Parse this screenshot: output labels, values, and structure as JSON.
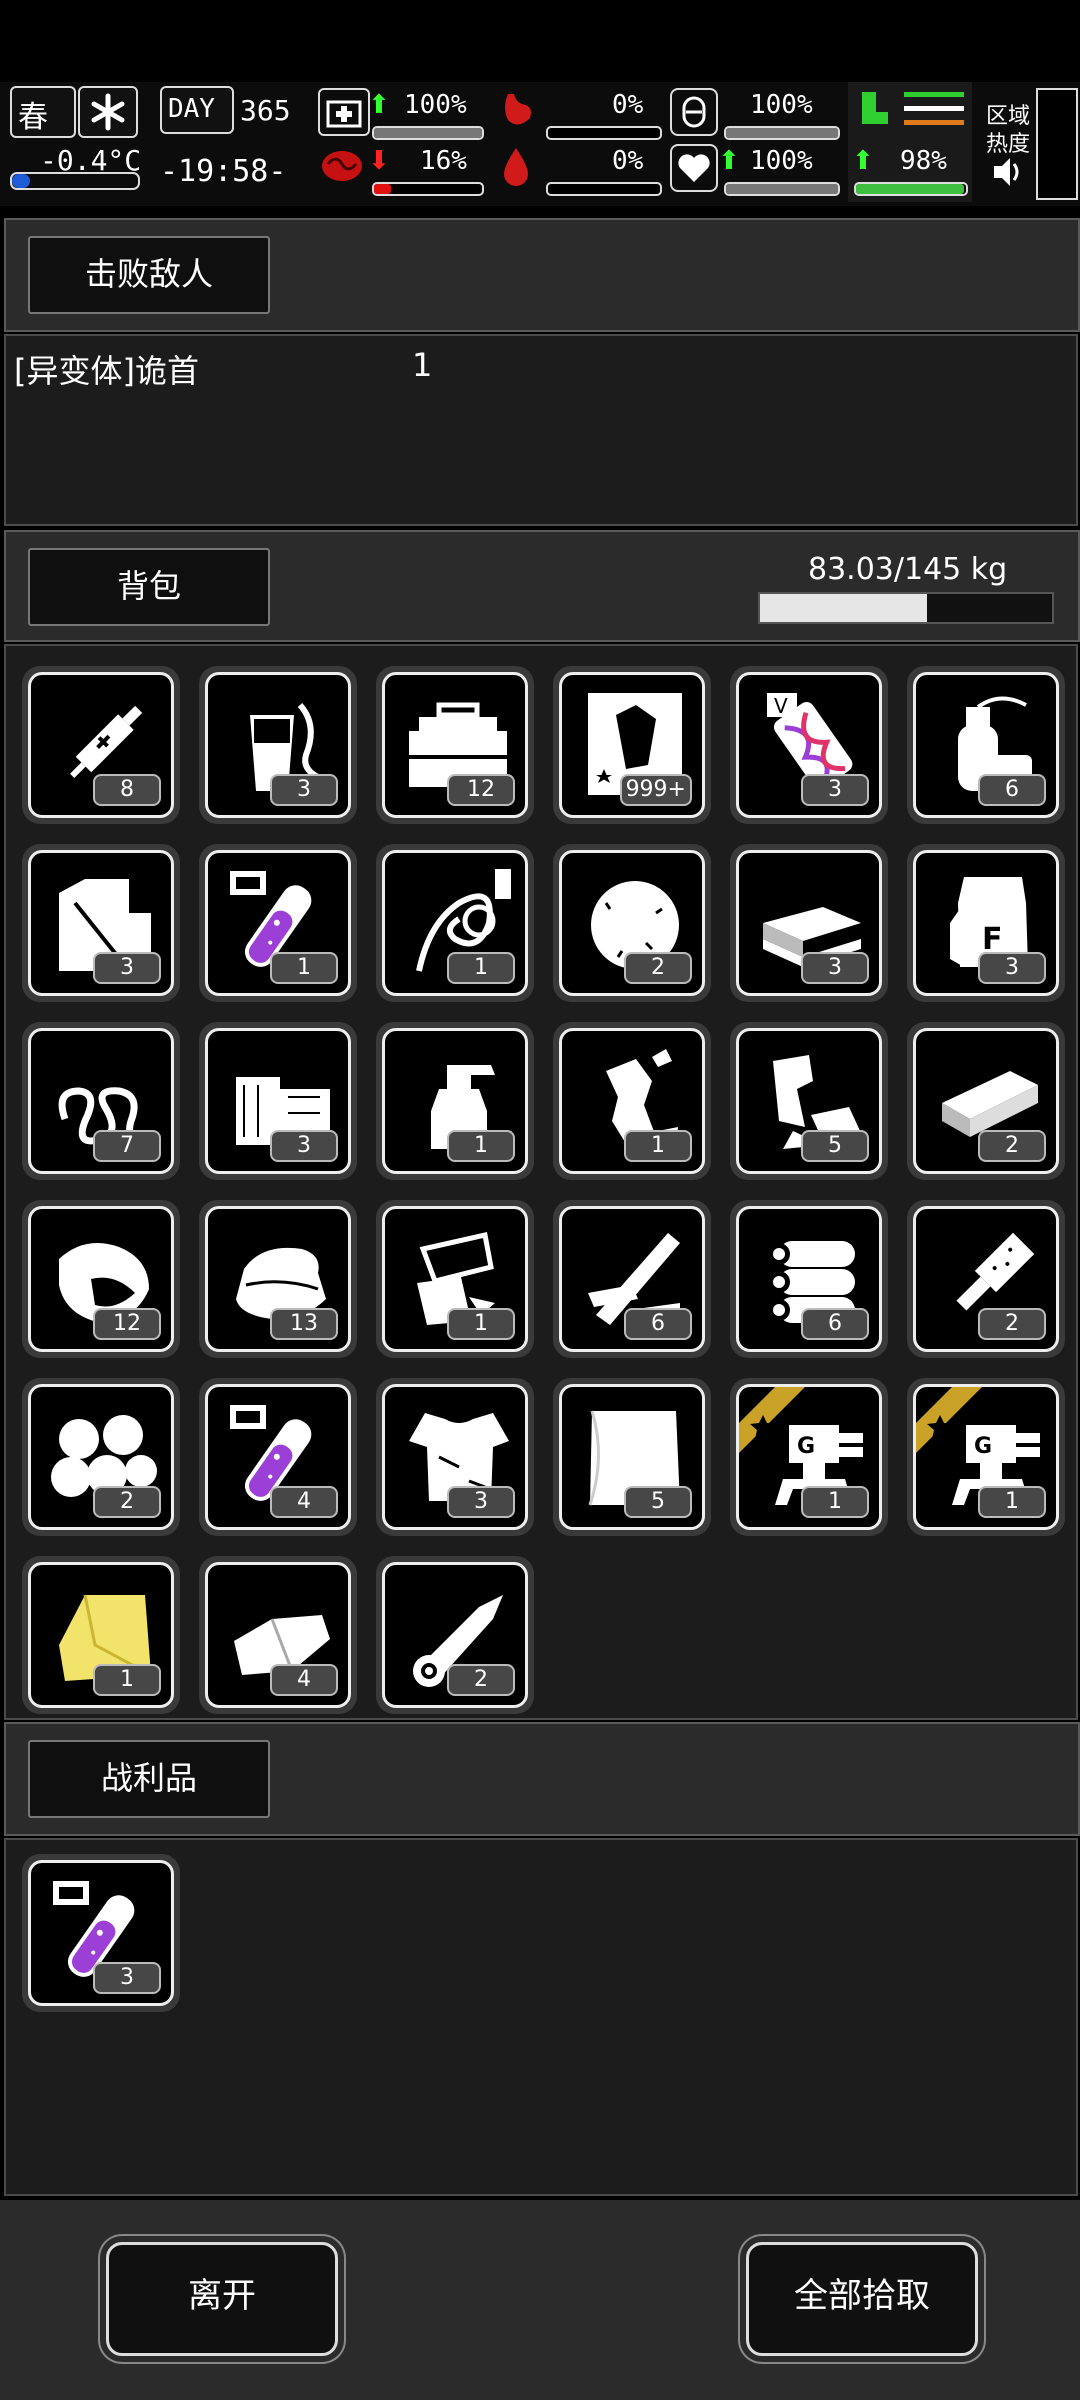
{
  "hud": {
    "season": "春",
    "temperature": "-0.4°C",
    "day_label": "DAY",
    "day_number": "365",
    "clock": "-19:58-",
    "health_pct": "100%",
    "hunger_pct": "0%",
    "armor_pct": "100%",
    "infection_pct": "16%",
    "bleed_pct": "0%",
    "heart_pct": "100%",
    "stamina_pct": "98%",
    "zone_heat_label_1": "区域",
    "zone_heat_label_2": "热度"
  },
  "sections": {
    "defeated_tab": "击败敌人",
    "backpack_tab": "背包",
    "loot_tab": "战利品"
  },
  "defeated": {
    "enemy_name": "[异变体]诡首",
    "enemy_count": "1"
  },
  "backpack": {
    "weight": "83.03/145 kg",
    "weight_fraction": 0.5726,
    "items": [
      {
        "icon": "syringe-icon",
        "count": "8"
      },
      {
        "icon": "drink-cup-icon",
        "count": "3"
      },
      {
        "icon": "toolbox-icon",
        "count": "12"
      },
      {
        "icon": "mutant-hand-card-icon",
        "count": "999+"
      },
      {
        "icon": "dna-vial-icon",
        "count": "3"
      },
      {
        "icon": "gas-canister-icon",
        "count": "6"
      },
      {
        "icon": "fuel-jerrycan-icon",
        "count": "3"
      },
      {
        "icon": "purple-test-tube-icon",
        "count": "1"
      },
      {
        "icon": "cable-icon",
        "count": "1"
      },
      {
        "icon": "cotton-icon",
        "count": "2"
      },
      {
        "icon": "stacked-planks-icon",
        "count": "3"
      },
      {
        "icon": "flour-sack-icon",
        "count": "3"
      },
      {
        "icon": "spring-icon",
        "count": "7"
      },
      {
        "icon": "wood-blocks-icon",
        "count": "3"
      },
      {
        "icon": "spray-bottle-icon",
        "count": "1"
      },
      {
        "icon": "crushed-bottle-icon",
        "count": "1"
      },
      {
        "icon": "scrap-metal-icon",
        "count": "5"
      },
      {
        "icon": "metal-plate-icon",
        "count": "2"
      },
      {
        "icon": "raw-meat-icon",
        "count": "12"
      },
      {
        "icon": "cloth-pile-icon",
        "count": "13"
      },
      {
        "icon": "paper-scraps-icon",
        "count": "1"
      },
      {
        "icon": "wooden-board-icon",
        "count": "6"
      },
      {
        "icon": "logs-icon",
        "count": "6"
      },
      {
        "icon": "chisel-tool-icon",
        "count": "2"
      },
      {
        "icon": "cotton-balls-icon",
        "count": "2"
      },
      {
        "icon": "purple-test-tube-icon",
        "count": "4"
      },
      {
        "icon": "torn-shirt-icon",
        "count": "3"
      },
      {
        "icon": "white-cloth-icon",
        "count": "5"
      },
      {
        "icon": "turret-icon",
        "count": "1",
        "starred": true
      },
      {
        "icon": "turret-icon",
        "count": "1",
        "starred": true
      },
      {
        "icon": "yellow-cloth-icon",
        "count": "1"
      },
      {
        "icon": "folded-cloth-icon",
        "count": "4"
      },
      {
        "icon": "paper-roll-icon",
        "count": "2"
      }
    ]
  },
  "loot": {
    "items": [
      {
        "icon": "purple-test-tube-icon",
        "count": "3"
      }
    ]
  },
  "buttons": {
    "leave": "离开",
    "pick_all": "全部拾取"
  },
  "colors": {
    "health_green": "#39d339",
    "infection_red": "#e01010",
    "stamina_green": "#3fbf3f",
    "accent_gold": "#c9a227",
    "vial_purple": "#9b3fd6",
    "hunger_red": "#d11a1a"
  }
}
